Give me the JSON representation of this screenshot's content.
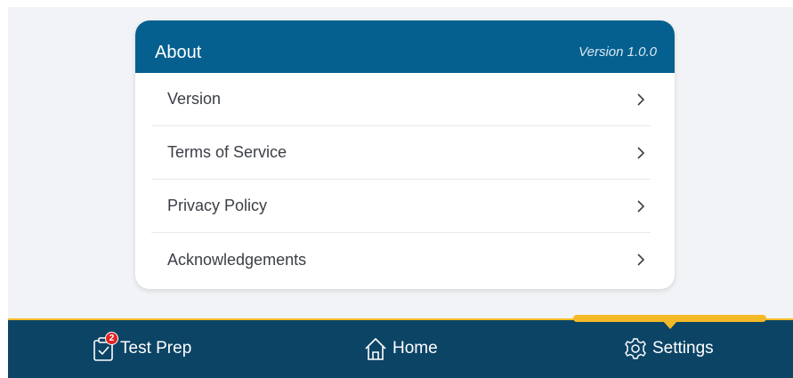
{
  "about": {
    "title": "About",
    "version_label": "Version 1.0.0",
    "items": [
      {
        "label": "Version"
      },
      {
        "label": "Terms of Service"
      },
      {
        "label": "Privacy Policy"
      },
      {
        "label": "Acknowledgements"
      }
    ]
  },
  "tabbar": {
    "test_prep": {
      "label": "Test Prep",
      "badge": "2",
      "icon": "clipboard-check-icon"
    },
    "home": {
      "label": "Home",
      "icon": "home-icon"
    },
    "settings": {
      "label": "Settings",
      "icon": "gear-icon",
      "active": true
    }
  },
  "colors": {
    "header": "#05608f",
    "tabbar": "#0c4466",
    "accent": "#f4b927",
    "badge": "#e02424",
    "background": "#f2f3f6"
  }
}
